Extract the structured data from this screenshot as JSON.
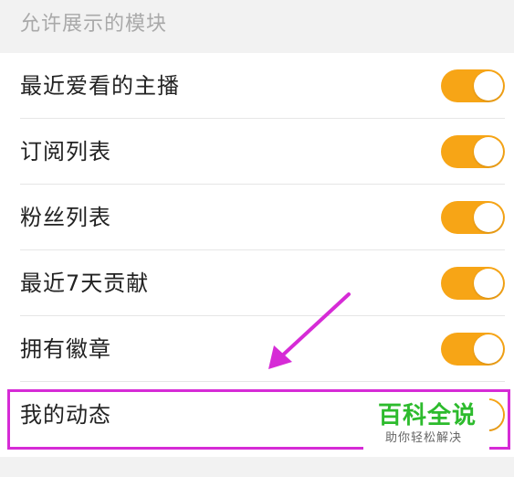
{
  "section": {
    "title": "允许展示的模块"
  },
  "settings": [
    {
      "label": "最近爱看的主播",
      "enabled": true
    },
    {
      "label": "订阅列表",
      "enabled": true
    },
    {
      "label": "粉丝列表",
      "enabled": true
    },
    {
      "label": "最近7天贡献",
      "enabled": true
    },
    {
      "label": "拥有徽章",
      "enabled": true
    },
    {
      "label": "我的动态",
      "enabled": false
    }
  ],
  "annotation": {
    "highlight_color": "#d62bd6",
    "arrow_color": "#d62bd6"
  },
  "watermark": {
    "title": "百科全说",
    "subtitle": "助你轻松解决"
  },
  "colors": {
    "toggle_on": "#f7a516",
    "background": "#f2f2f2"
  }
}
